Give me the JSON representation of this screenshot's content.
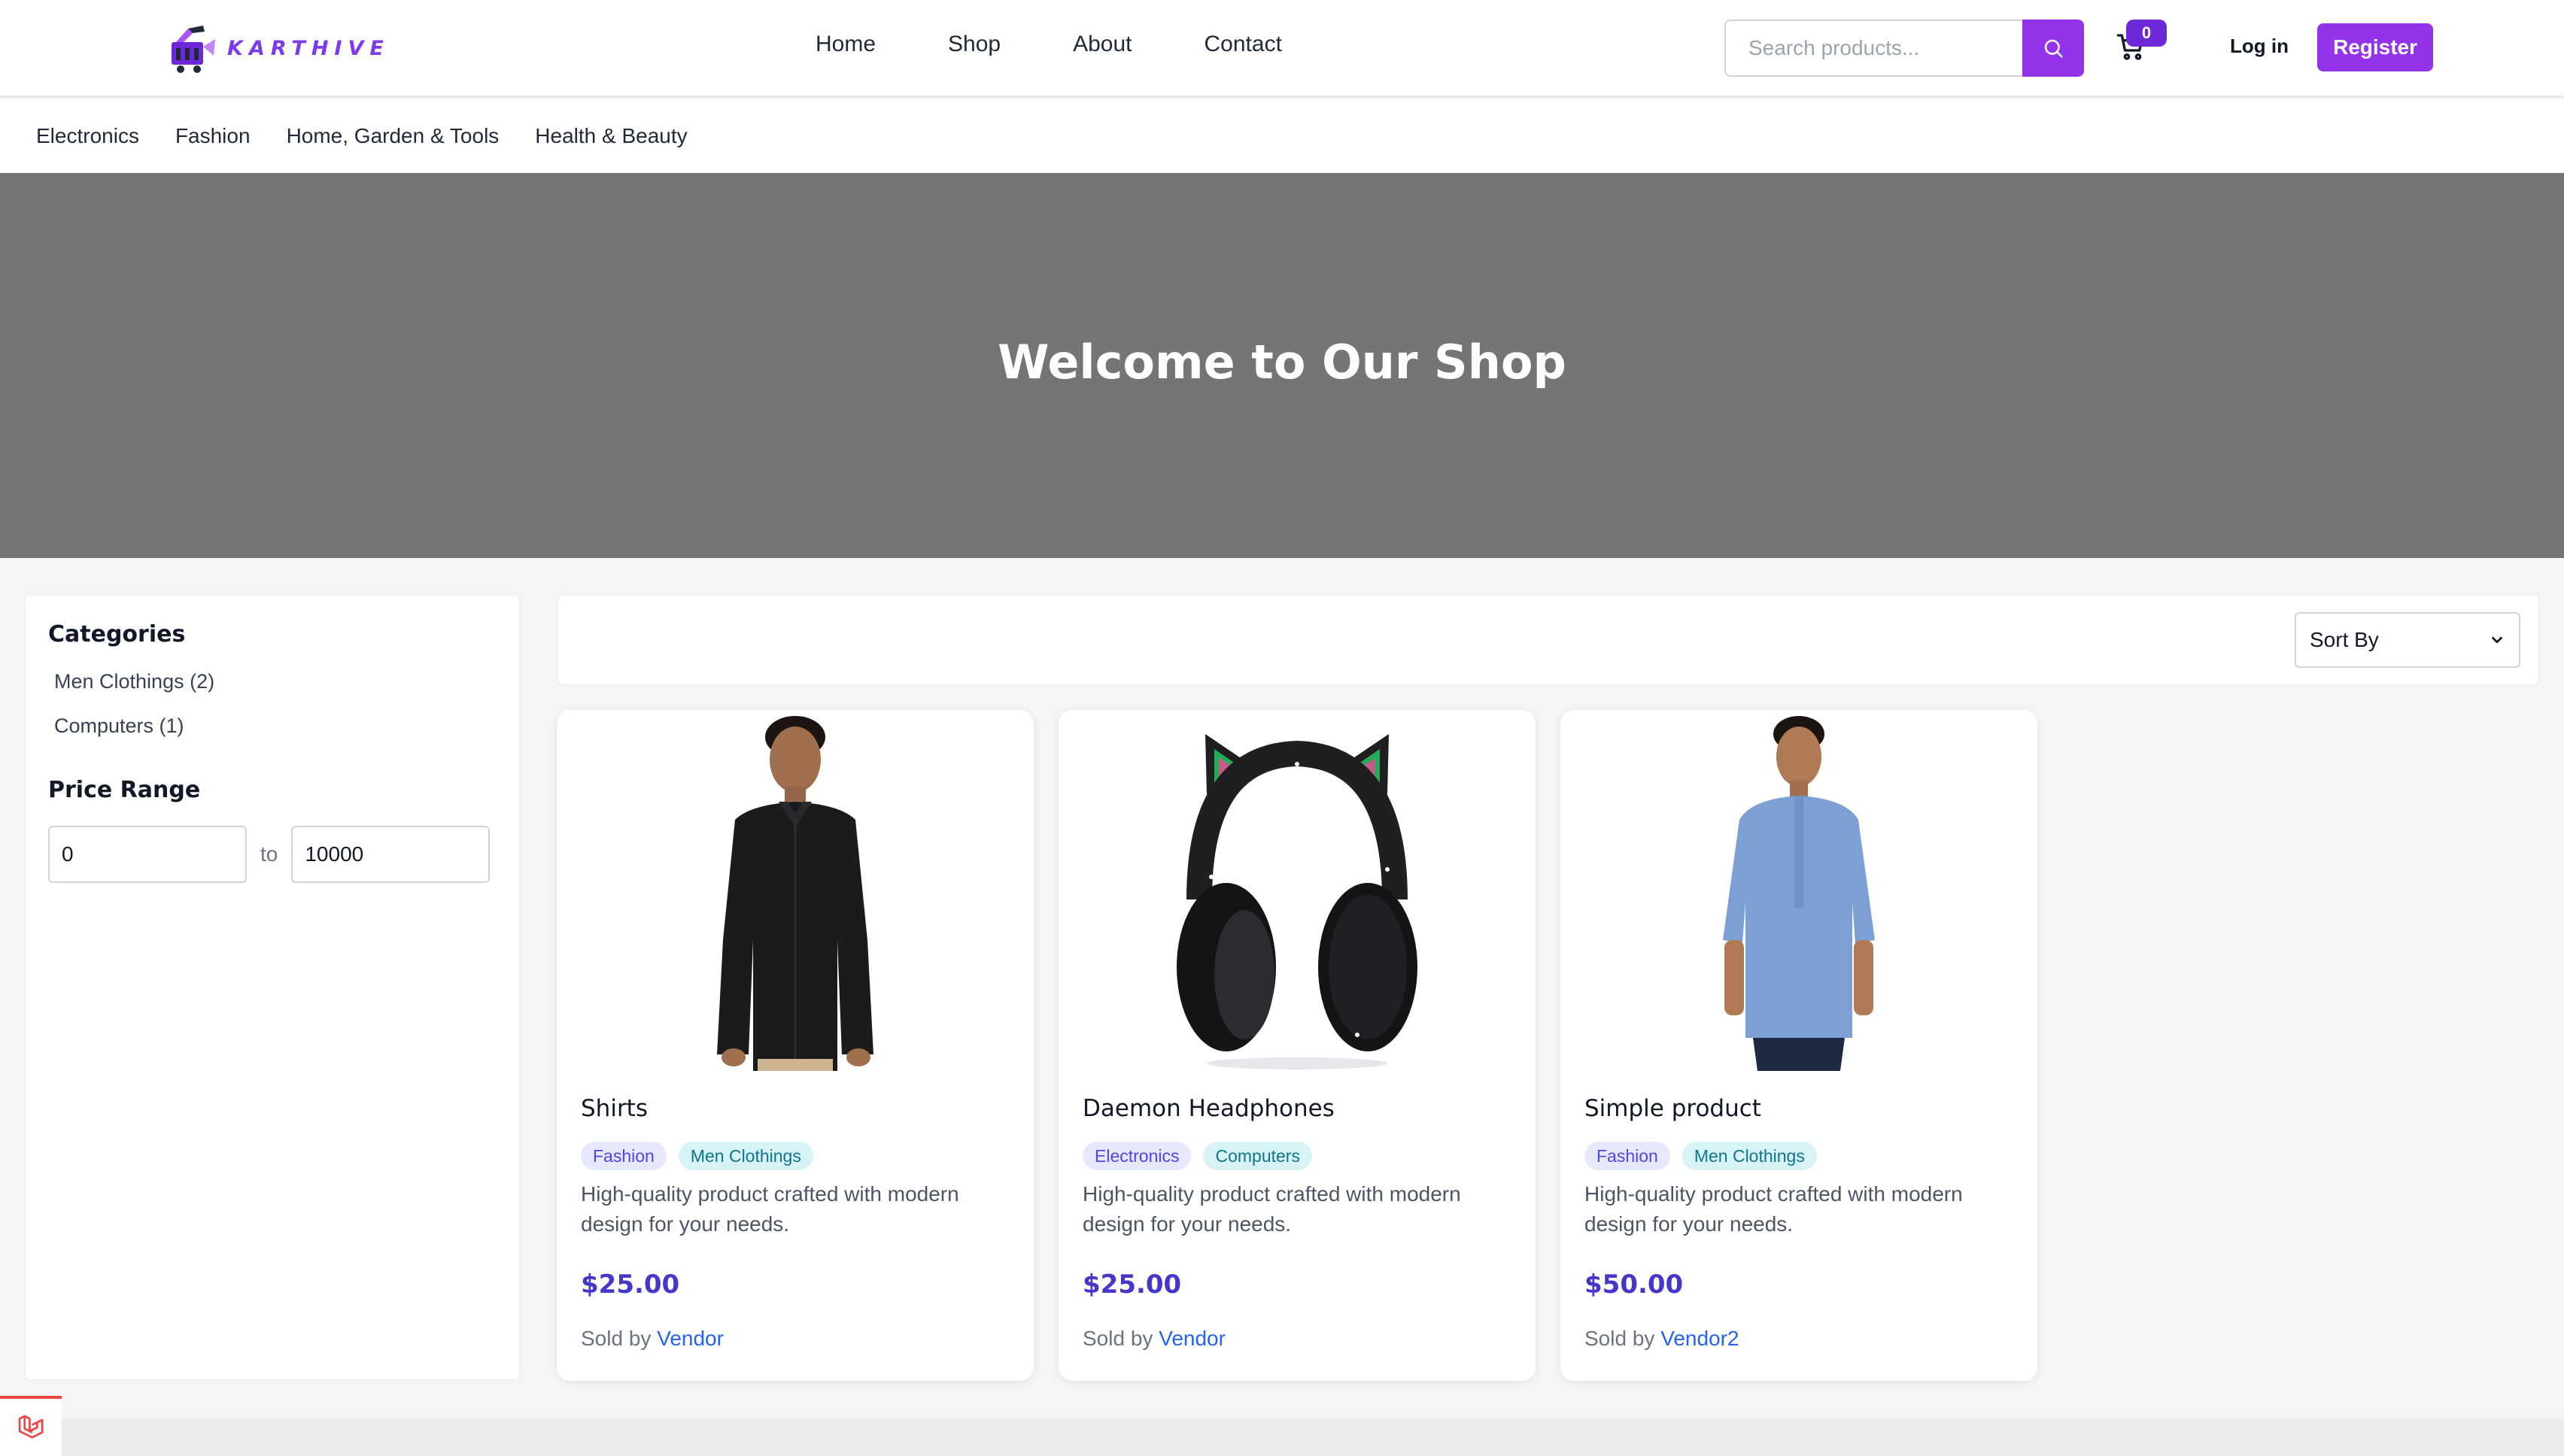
{
  "header": {
    "logo_text": "KARTHIVE",
    "nav": [
      "Home",
      "Shop",
      "About",
      "Contact"
    ],
    "search_placeholder": "Search products...",
    "cart_count": "0",
    "login_label": "Log in",
    "register_label": "Register"
  },
  "category_bar": [
    "Electronics",
    "Fashion",
    "Home, Garden & Tools",
    "Health & Beauty"
  ],
  "hero": {
    "title": "Welcome to Our Shop"
  },
  "sidebar": {
    "categories_title": "Categories",
    "categories": [
      "Men Clothings (2)",
      "Computers (1)"
    ],
    "price_title": "Price Range",
    "price_min": "0",
    "price_to_label": "to",
    "price_max": "10000"
  },
  "toolbar": {
    "sort_label": "Sort By"
  },
  "products": [
    {
      "name": "Shirts",
      "tags": [
        "Fashion",
        "Men Clothings"
      ],
      "description": "High-quality product crafted with modern design for your needs.",
      "price": "$25.00",
      "sold_by_label": "Sold by",
      "vendor": "Vendor"
    },
    {
      "name": "Daemon Headphones",
      "tags": [
        "Electronics",
        "Computers"
      ],
      "description": "High-quality product crafted with modern design for your needs.",
      "price": "$25.00",
      "sold_by_label": "Sold by",
      "vendor": "Vendor"
    },
    {
      "name": "Simple product",
      "tags": [
        "Fashion",
        "Men Clothings"
      ],
      "description": "High-quality product crafted with modern design for your needs.",
      "price": "$50.00",
      "sold_by_label": "Sold by",
      "vendor": "Vendor2"
    }
  ],
  "colors": {
    "brand": "#9333ea",
    "badge": "#6d28d9",
    "hero_bg": "#757577",
    "price": "#4338ca",
    "vendor_link": "#2563eb"
  },
  "icons": [
    "search-icon",
    "cart-icon",
    "laravel-icon",
    "chevron-down-icon"
  ]
}
